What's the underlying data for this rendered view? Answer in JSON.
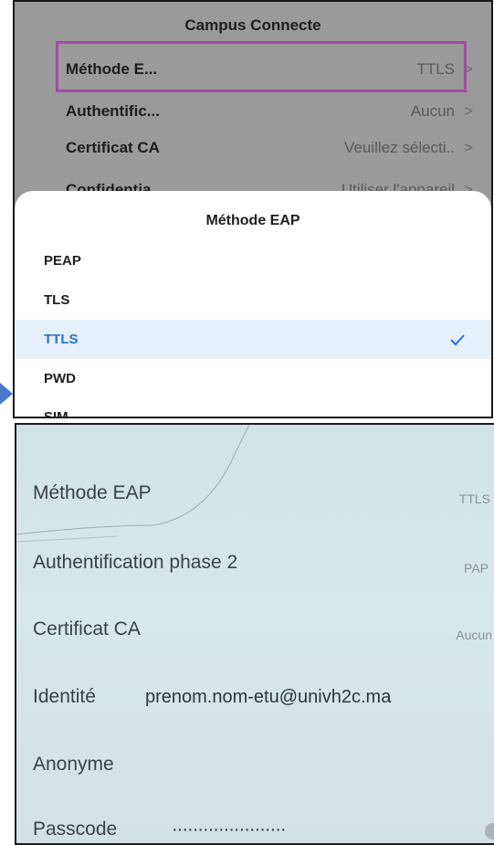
{
  "top_panel": {
    "network_title": "Campus Connecte",
    "rows": {
      "eap_method": {
        "label": "Méthode E...",
        "value": "TTLS"
      },
      "phase2": {
        "label": "Authentific...",
        "value": "Aucun"
      },
      "ca_cert": {
        "label": "Certificat CA",
        "value": "Veuillez sélecti.."
      },
      "partial": {
        "label": "Confidentia...",
        "value": "Utiliser l'appareil"
      }
    },
    "chevron": ">",
    "sheet": {
      "title": "Méthode EAP",
      "options": [
        "PEAP",
        "TLS",
        "TTLS",
        "PWD",
        "SIM"
      ],
      "selected": "TTLS"
    },
    "colors": {
      "highlight": "#a54aa6",
      "selected_text": "#2a6fd6",
      "selected_bg": "#e6f0fa"
    }
  },
  "bottom_panel": {
    "eap_method": {
      "label": "Méthode EAP",
      "value": "TTLS"
    },
    "phase2": {
      "label": "Authentification phase 2",
      "value": "PAP"
    },
    "ca_cert": {
      "label": "Certificat CA",
      "value": "Aucun"
    },
    "identity": {
      "label": "Identité",
      "value": "prenom.nom-etu@univh2c.ma"
    },
    "anonymous": {
      "label": "Anonyme",
      "value": ""
    },
    "passcode": {
      "label": "Passcode",
      "value": "······················"
    }
  }
}
